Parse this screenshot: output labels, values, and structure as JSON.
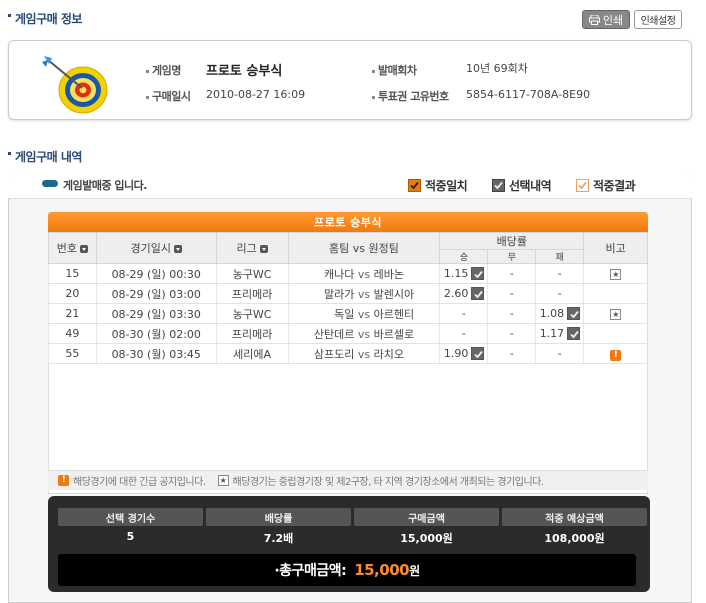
{
  "purchase_info": {
    "section_title": "게임구매 정보",
    "print_label": "인쇄",
    "print_settings_label": "인쇄설정",
    "game_name_label": "게임명",
    "game_name": "프로토 승부식",
    "purchase_date_label": "구매일시",
    "purchase_date": "2010-08-27 16:09",
    "round_label": "발매회차",
    "round": "10년 69회차",
    "ticket_id_label": "투표권 고유번호",
    "ticket_id": "5854-6117-708A-8E90"
  },
  "purchase_list": {
    "section_title": "게임구매 내역",
    "status_text": "게임발매중 입니다.",
    "legend": [
      {
        "label": "적중일치",
        "color": "#e87a10"
      },
      {
        "label": "선택내역",
        "color": "#666666"
      },
      {
        "label": "적중결과",
        "color": "#f0b070"
      }
    ],
    "table_title": "프로토 승부식",
    "columns": {
      "no": "번호",
      "datetime": "경기일시",
      "league": "리그",
      "match": "홈팀 vs 원정팀",
      "odds": "배당률",
      "win": "승",
      "draw": "무",
      "lose": "패",
      "note": "비고"
    },
    "vs": "vs",
    "rows": [
      {
        "no": "15",
        "datetime": "08-29 (일) 00:30",
        "league": "농구WC",
        "home": "캐나다",
        "away": "레바논",
        "win": "1.15",
        "draw": "-",
        "lose": "-",
        "pick": "win",
        "note": "star"
      },
      {
        "no": "20",
        "datetime": "08-29 (일) 03:00",
        "league": "프리메라",
        "home": "말라가",
        "away": "발렌시아",
        "win": "2.60",
        "draw": "-",
        "lose": "-",
        "pick": "win",
        "note": ""
      },
      {
        "no": "21",
        "datetime": "08-29 (일) 03:30",
        "league": "농구WC",
        "home": "독일",
        "away": "아르헨티",
        "win": "-",
        "draw": "-",
        "lose": "1.08",
        "pick": "lose",
        "note": "star"
      },
      {
        "no": "49",
        "datetime": "08-30 (월) 02:00",
        "league": "프리메라",
        "home": "산탄데르",
        "away": "바르셀로",
        "win": "-",
        "draw": "-",
        "lose": "1.17",
        "pick": "lose",
        "note": ""
      },
      {
        "no": "55",
        "datetime": "08-30 (월) 03:45",
        "league": "세리에A",
        "home": "삼프도리",
        "away": "라치오",
        "win": "1.90",
        "draw": "-",
        "lose": "-",
        "pick": "win",
        "note": "warn"
      }
    ],
    "note_warn": "해당경기에 대한 긴급 공지입니다.",
    "note_star": "해당경기는 중립경기장 및 제2구장, 타 지역 경기장소에서 개최되는 경기입니다."
  },
  "summary": {
    "selected_count_label": "선택 경기수",
    "selected_count": "5",
    "odds_label": "배당률",
    "odds": "7.2배",
    "purchase_amount_label": "구매금액",
    "purchase_amount": "15,000원",
    "expected_label": "적중 예상금액",
    "expected": "108,000원",
    "total_label": "·총구매금액:",
    "total_amount": "15,000",
    "total_unit": "원"
  }
}
